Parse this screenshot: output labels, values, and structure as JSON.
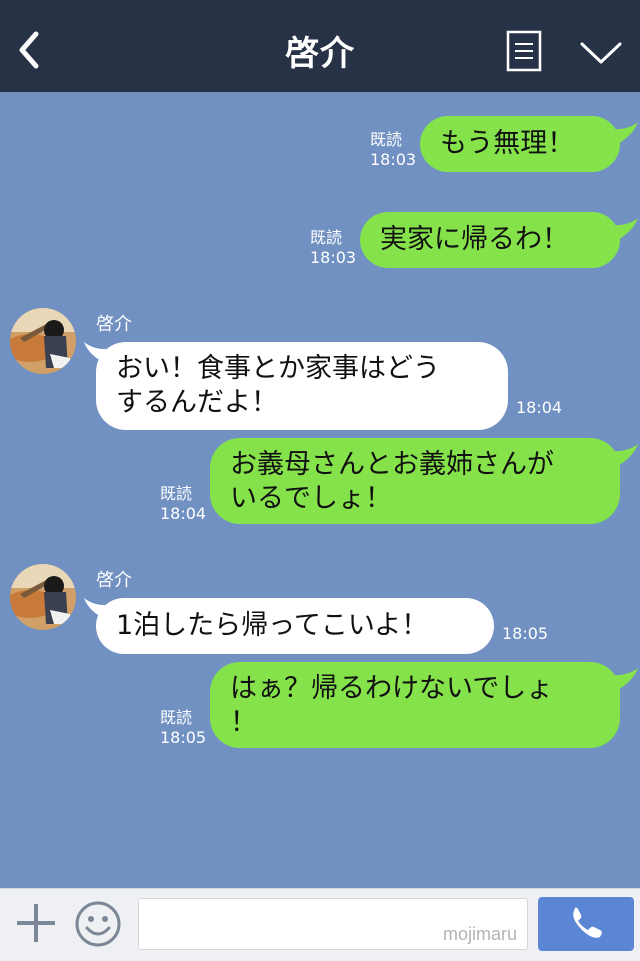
{
  "header": {
    "title": "啓介"
  },
  "messages": [
    {
      "text": "もう無理！",
      "read": "既読",
      "time": "18:03"
    },
    {
      "text": "実家に帰るわ！",
      "read": "既読",
      "time": "18:03"
    },
    {
      "sender": "啓介",
      "line1": "おい！食事とか家事はどう",
      "line2": "するんだよ！",
      "time": "18:04"
    },
    {
      "line1": "お義母さんとお義姉さんが",
      "line2": "いるでしょ！",
      "read": "既読",
      "time": "18:04"
    },
    {
      "sender": "啓介",
      "text": "1泊したら帰ってこいよ！",
      "time": "18:05"
    },
    {
      "line1": "はぁ？帰るわけないでしょ",
      "line2": "！",
      "read": "既読",
      "time": "18:05"
    }
  ],
  "input": {
    "placeholder": "",
    "watermark": "mojimaru"
  },
  "colors": {
    "header_bg": "#273246",
    "chat_bg": "#7091c2",
    "sent_bubble": "#85e24a",
    "recv_bubble": "#ffffff",
    "call_button": "#5b86d6"
  },
  "icons": [
    "back-arrow-icon",
    "menu-list-icon",
    "chevron-down-icon",
    "plus-icon",
    "emoji-icon",
    "phone-icon"
  ]
}
